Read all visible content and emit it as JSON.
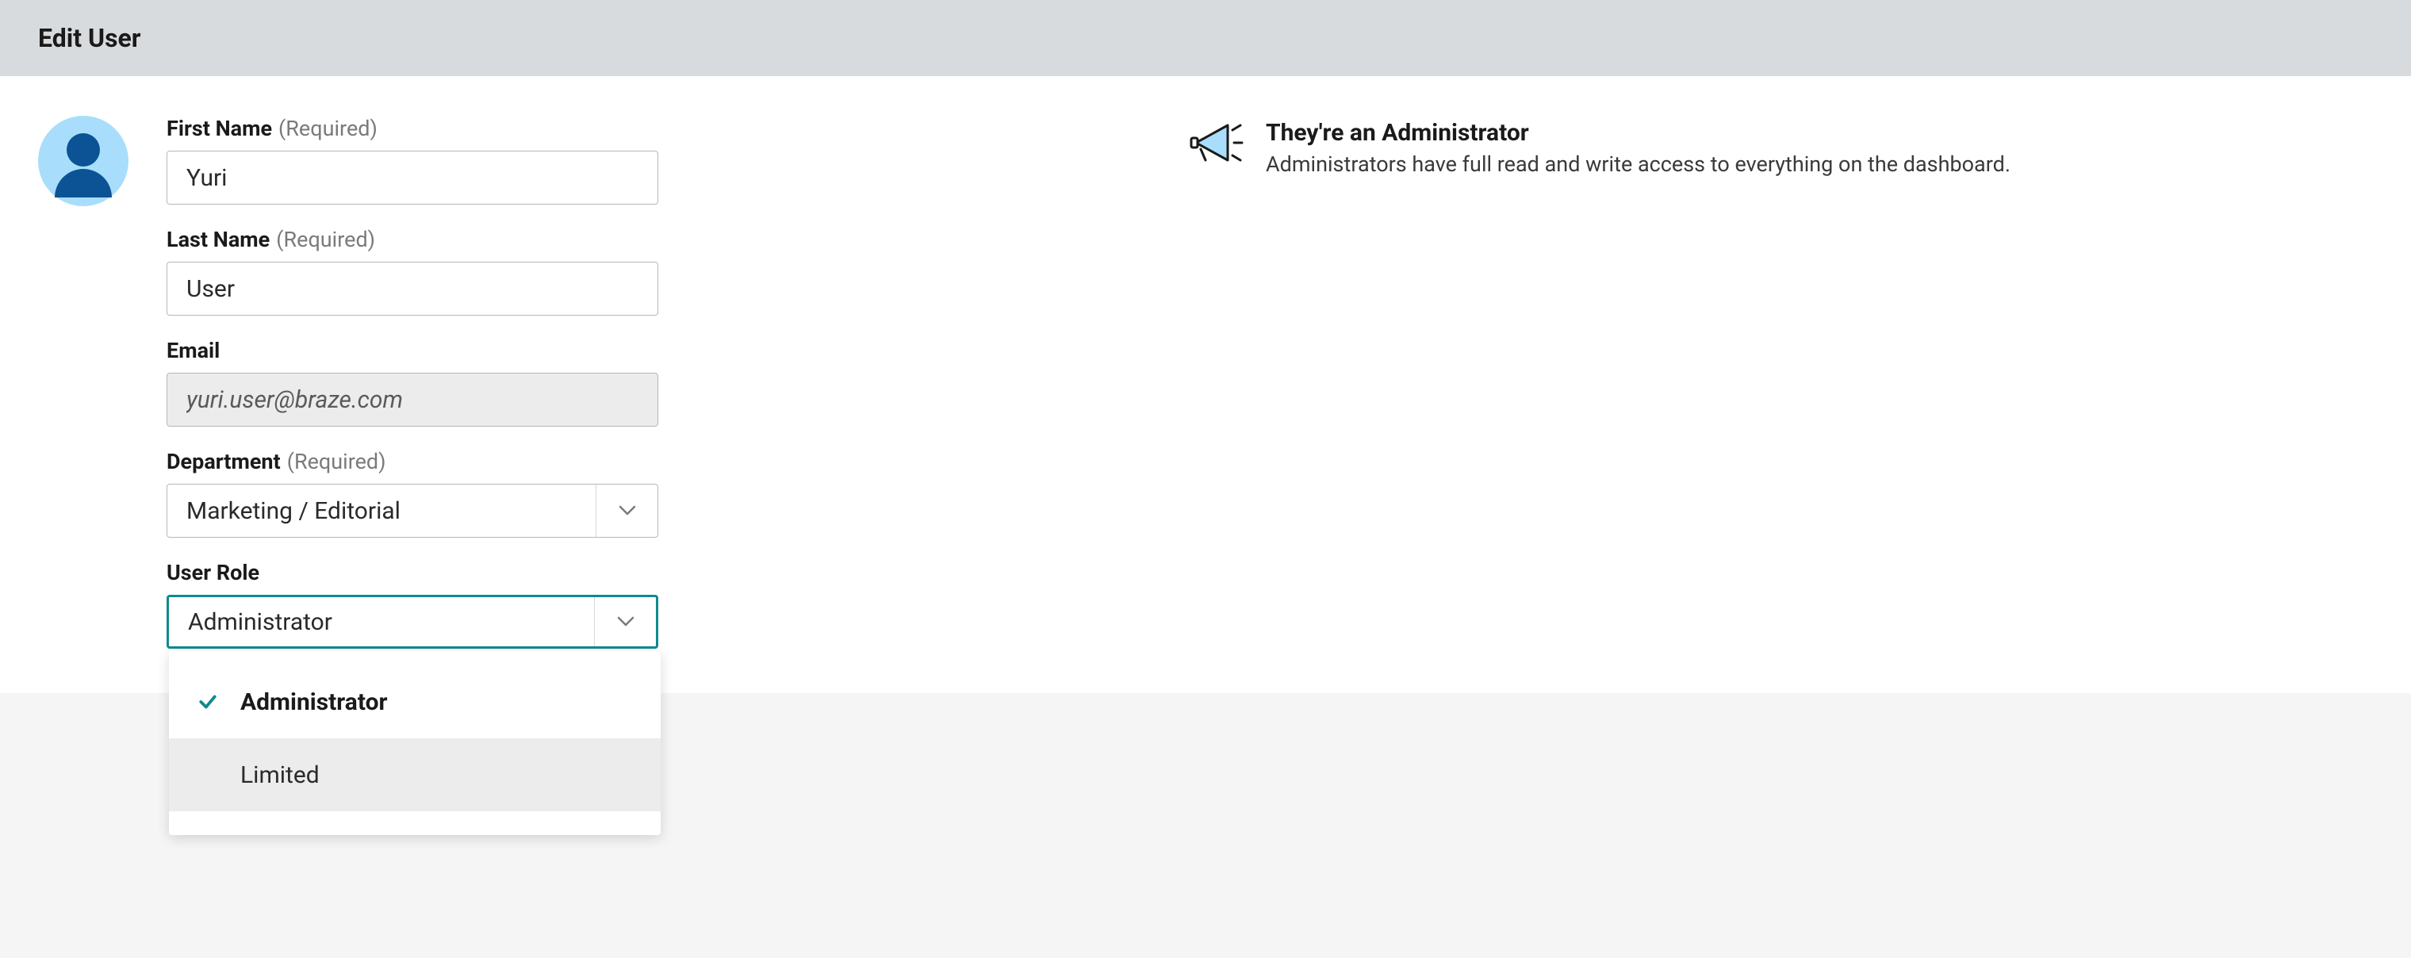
{
  "header": {
    "title": "Edit User"
  },
  "form": {
    "first_name": {
      "label": "First Name",
      "required": "(Required)",
      "value": "Yuri"
    },
    "last_name": {
      "label": "Last Name",
      "required": "(Required)",
      "value": "User"
    },
    "email": {
      "label": "Email",
      "value": "yuri.user@braze.com"
    },
    "department": {
      "label": "Department",
      "required": "(Required)",
      "value": "Marketing / Editorial"
    },
    "user_role": {
      "label": "User Role",
      "value": "Administrator",
      "options": [
        {
          "label": "Administrator",
          "selected": true
        },
        {
          "label": "Limited",
          "selected": false
        }
      ]
    }
  },
  "info": {
    "title": "They're an Administrator",
    "description": "Administrators have full read and write access to everything on the dashboard."
  }
}
